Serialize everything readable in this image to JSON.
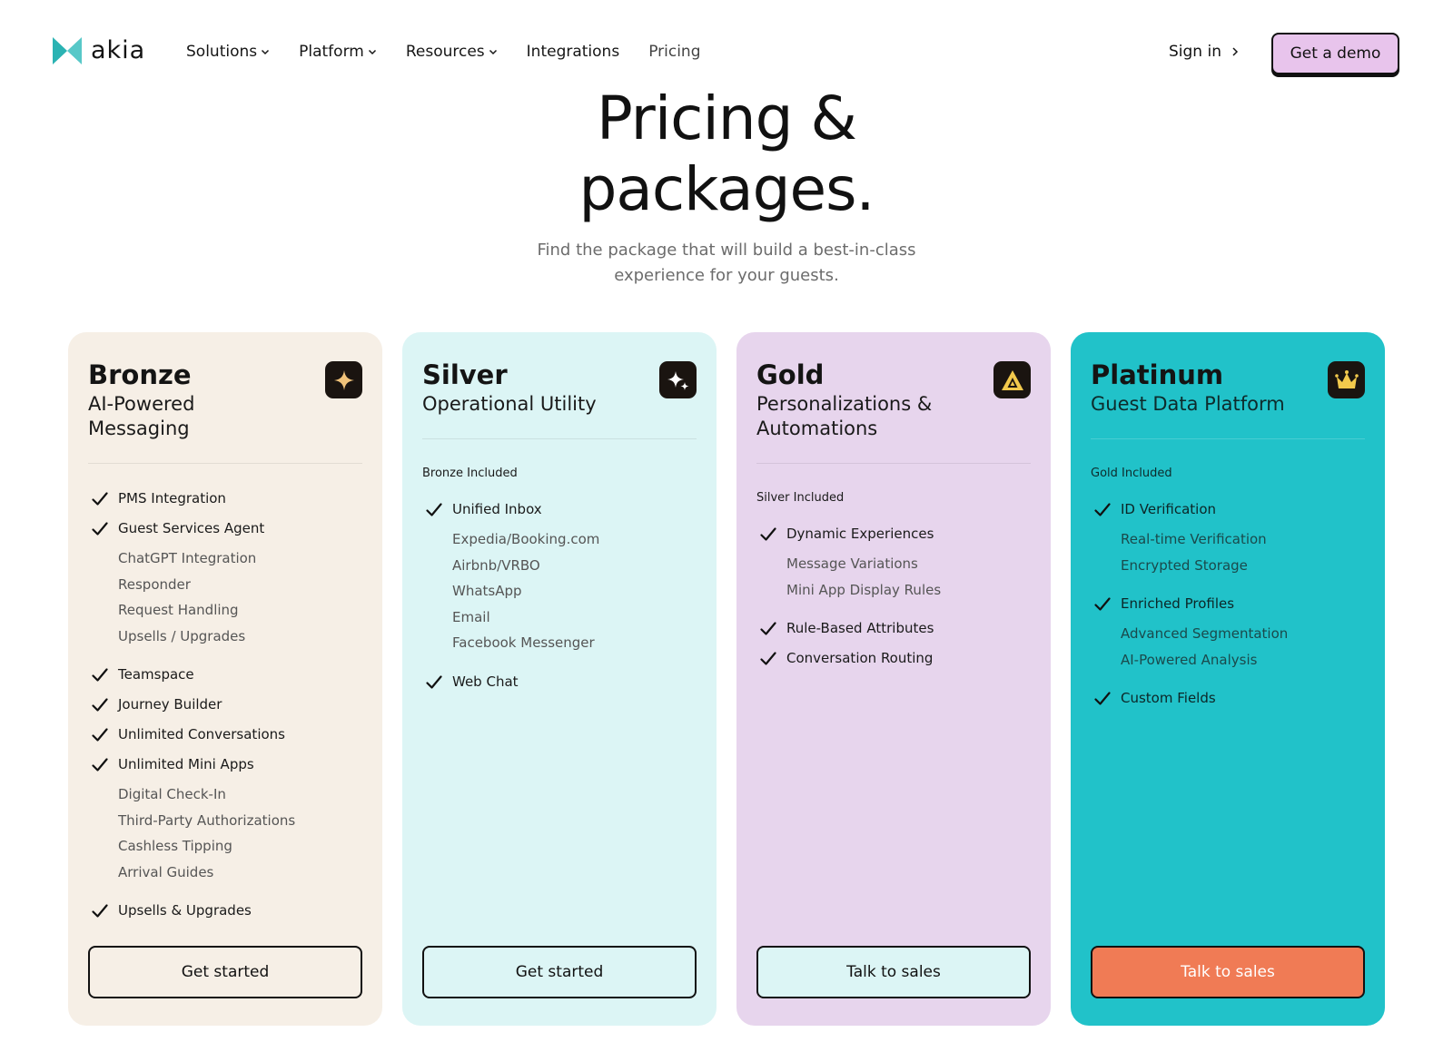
{
  "brand": {
    "name": "akia",
    "mark_color_left": "#2bb3b3",
    "mark_color_right": "#57c8c8"
  },
  "nav": {
    "items": [
      {
        "label": "Solutions",
        "dropdown": true
      },
      {
        "label": "Platform",
        "dropdown": true
      },
      {
        "label": "Resources",
        "dropdown": true
      },
      {
        "label": "Integrations",
        "dropdown": false
      },
      {
        "label": "Pricing",
        "dropdown": false
      }
    ],
    "sign_in": "Sign in",
    "demo": "Get a demo"
  },
  "hero": {
    "title_line1": "Pricing &",
    "title_line2": "packages.",
    "sub_line1": "Find the package that will build a best-in-class",
    "sub_line2": "experience for your guests."
  },
  "colors": {
    "bronze": "#f6efe6",
    "silver": "#dcf5f5",
    "gold": "#e7d5ed",
    "platinum": "#21c2c9",
    "cta_orange": "#f07b55",
    "demo_button": "#e8c4ec"
  },
  "plans": [
    {
      "name": "Bronze",
      "desc": "AI-Powered Messaging",
      "icon": "sparkle-icon",
      "included": "",
      "features": [
        {
          "label": "PMS Integration",
          "subs": []
        },
        {
          "label": "Guest Services Agent",
          "subs": [
            "ChatGPT Integration",
            "Responder",
            "Request Handling",
            "Upsells / Upgrades"
          ]
        },
        {
          "label": "Teamspace",
          "subs": []
        },
        {
          "label": "Journey Builder",
          "subs": []
        },
        {
          "label": "Unlimited Conversations",
          "subs": []
        },
        {
          "label": "Unlimited Mini Apps",
          "subs": [
            "Digital Check-In",
            "Third-Party Authorizations",
            "Cashless Tipping",
            "Arrival Guides"
          ]
        },
        {
          "label": "Upsells & Upgrades",
          "subs": []
        }
      ],
      "cta": "Get started"
    },
    {
      "name": "Silver",
      "desc": "Operational Utility",
      "icon": "sparkles-icon",
      "included": "Bronze Included",
      "features": [
        {
          "label": "Unified Inbox",
          "subs": [
            "Expedia/Booking.com",
            "Airbnb/VRBO",
            "WhatsApp",
            "Email",
            "Facebook Messenger"
          ]
        },
        {
          "label": "Web Chat",
          "subs": []
        }
      ],
      "cta": "Get started"
    },
    {
      "name": "Gold",
      "desc": "Personalizations & Automations",
      "icon": "triangle-a-icon",
      "included": "Silver Included",
      "features": [
        {
          "label": "Dynamic Experiences",
          "subs": [
            "Message Variations",
            "Mini App Display Rules"
          ]
        },
        {
          "label": "Rule-Based Attributes",
          "subs": []
        },
        {
          "label": "Conversation Routing",
          "subs": []
        }
      ],
      "cta": "Talk to sales"
    },
    {
      "name": "Platinum",
      "desc": "Guest Data Platform",
      "icon": "crown-icon",
      "included": "Gold Included",
      "features": [
        {
          "label": "ID Verification",
          "subs": [
            "Real-time Verification",
            "Encrypted Storage"
          ]
        },
        {
          "label": "Enriched Profiles",
          "subs": [
            "Advanced Segmentation",
            "AI-Powered Analysis"
          ]
        },
        {
          "label": "Custom Fields",
          "subs": []
        }
      ],
      "cta": "Talk to sales"
    }
  ]
}
